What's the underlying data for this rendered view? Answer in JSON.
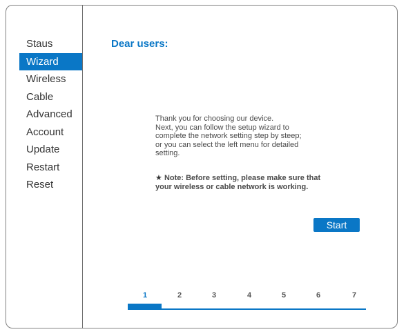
{
  "sidebar": {
    "items": [
      {
        "label": "Staus",
        "active": false
      },
      {
        "label": "Wizard",
        "active": true
      },
      {
        "label": "Wireless",
        "active": false
      },
      {
        "label": "Cable",
        "active": false
      },
      {
        "label": "Advanced",
        "active": false
      },
      {
        "label": "Account",
        "active": false
      },
      {
        "label": "Update",
        "active": false
      },
      {
        "label": "Restart",
        "active": false
      },
      {
        "label": "Reset",
        "active": false
      }
    ]
  },
  "main": {
    "title": "Dear users:",
    "intro": [
      "Thank you for choosing our device.",
      "Next, you can follow the setup wizard to",
      "complete the network setting step by steep;",
      "or you can select the left menu for detailed",
      "setting."
    ],
    "note_star": "★",
    "note": [
      "Note: Before setting, please make sure that",
      "your wireless or cable network is working."
    ],
    "start_label": "Start"
  },
  "wizard": {
    "steps": [
      "1",
      "2",
      "3",
      "4",
      "5",
      "6",
      "7"
    ],
    "current_step": 1,
    "total_steps": 7
  },
  "colors": {
    "accent": "#0a77c6",
    "text": "#333333",
    "border": "#7f7f7f"
  }
}
